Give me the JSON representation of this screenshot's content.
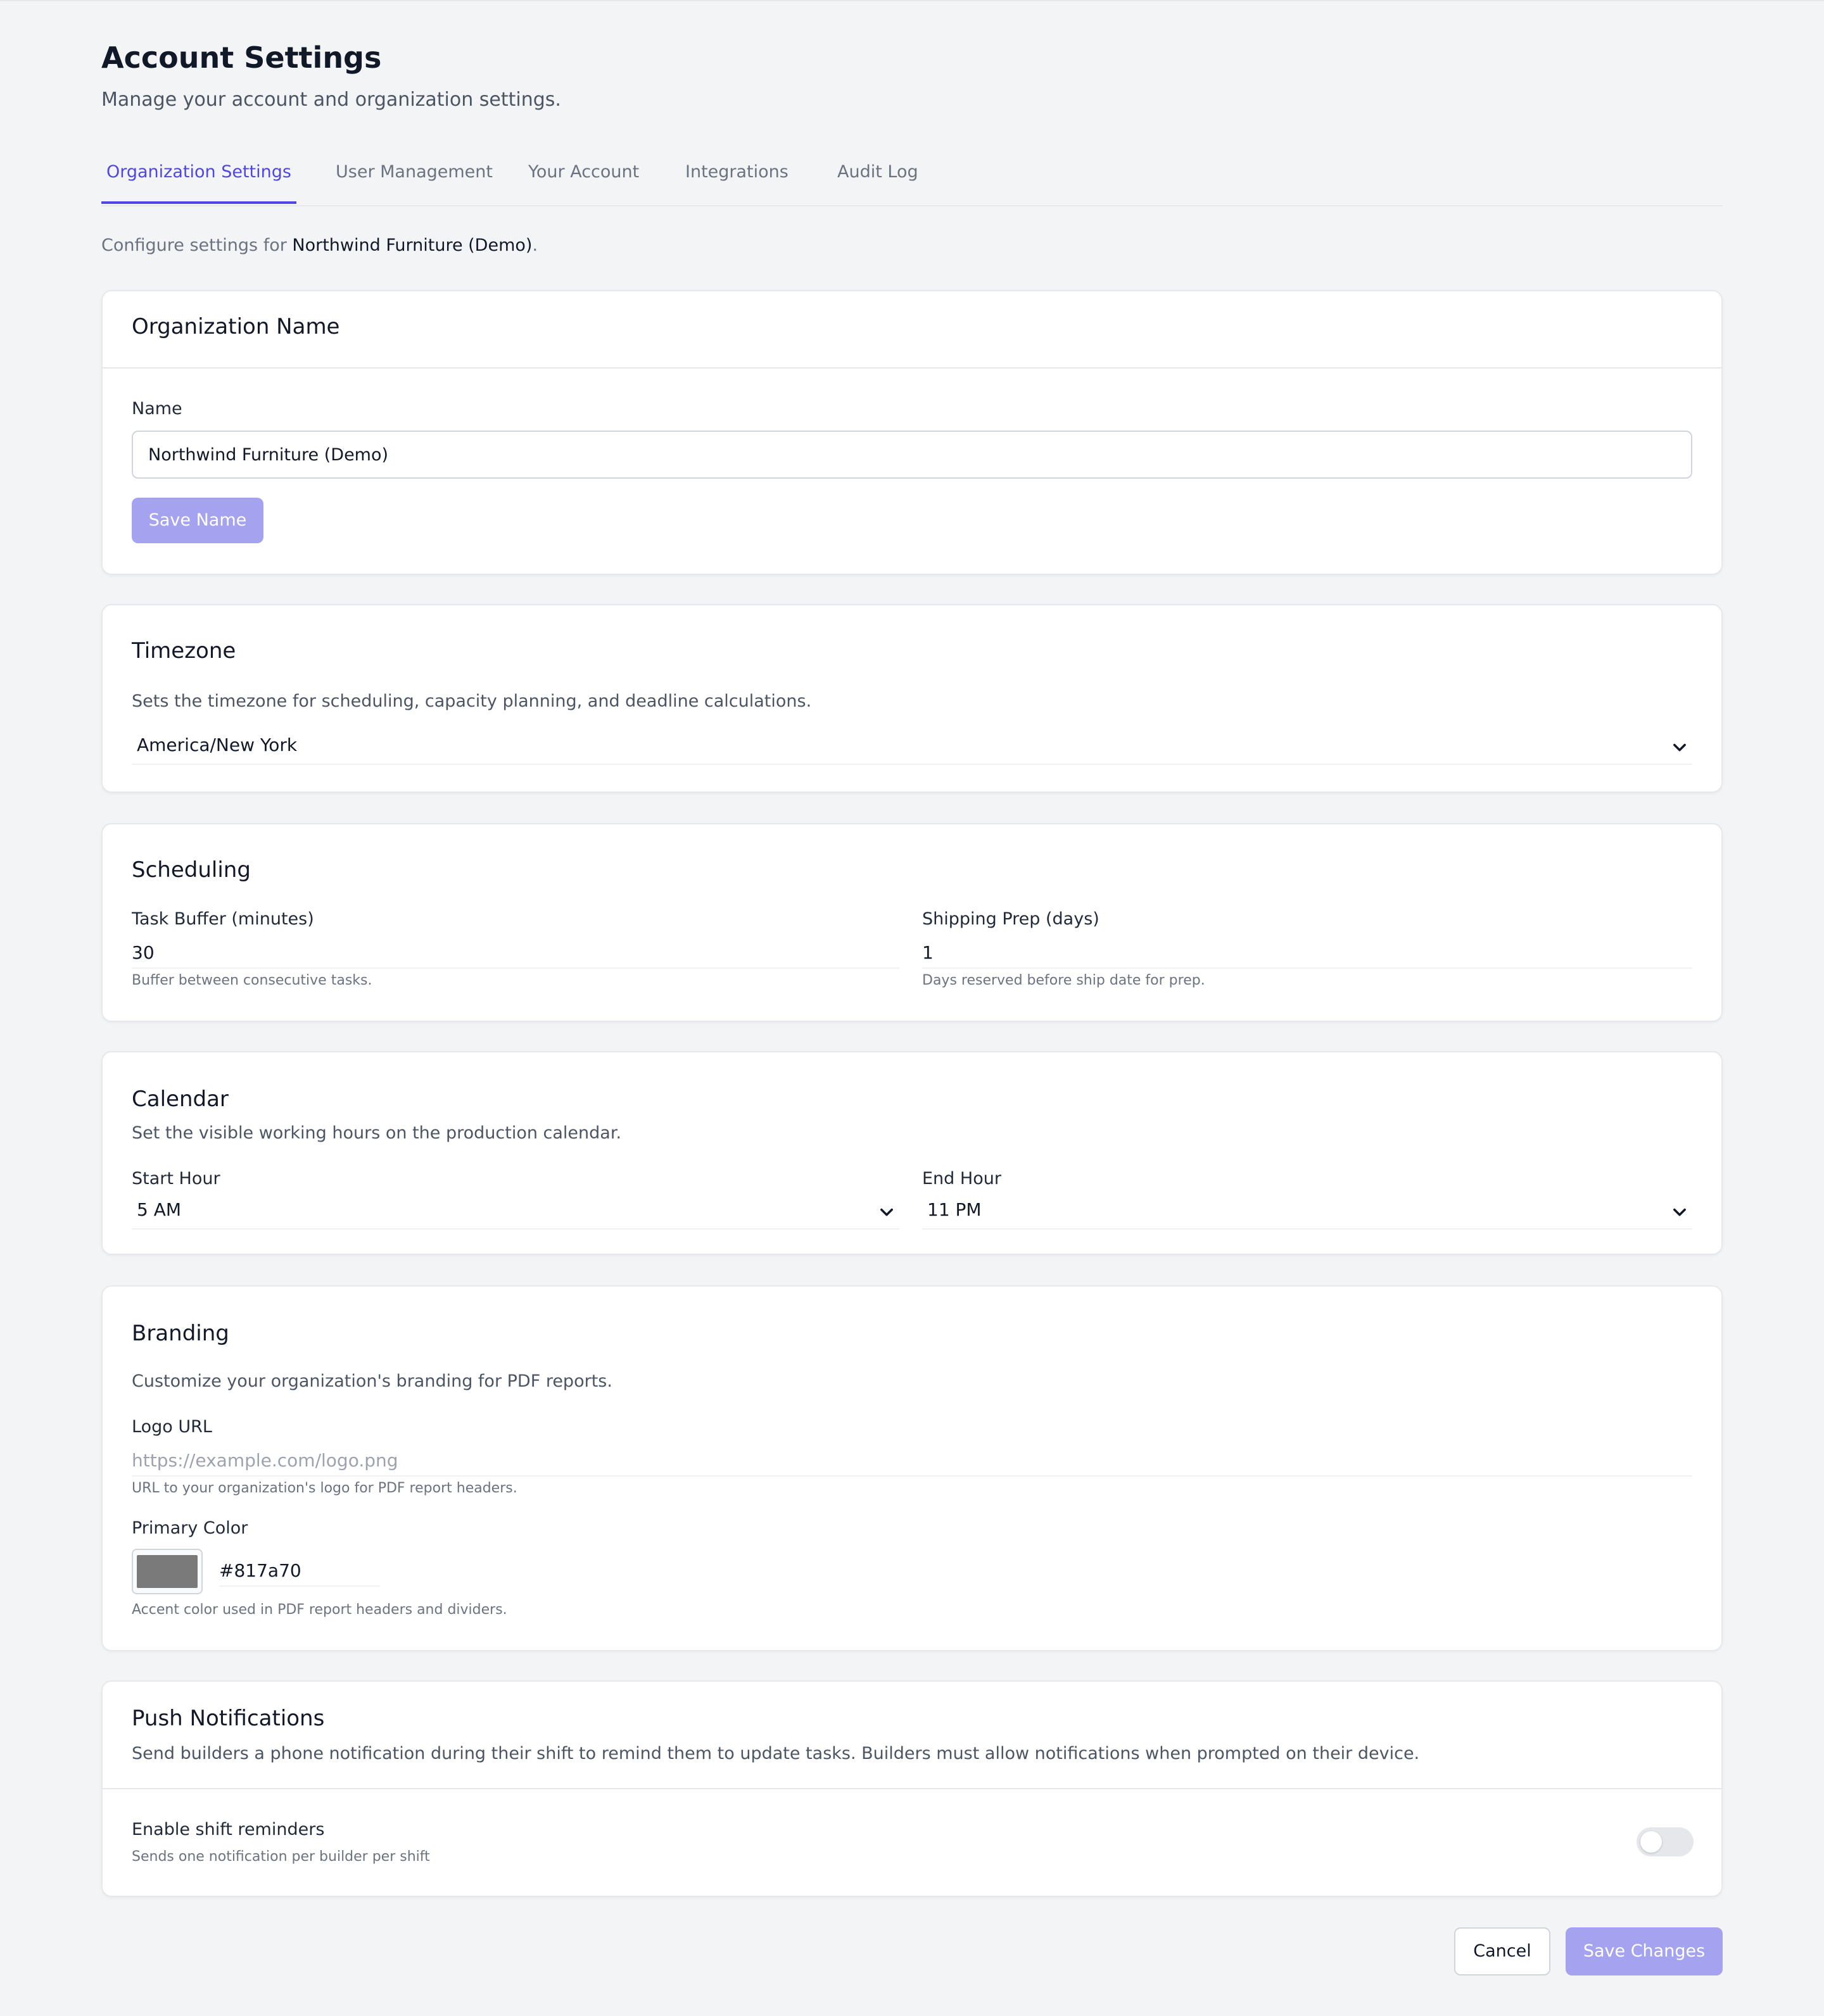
{
  "header": {
    "title": "Account Settings",
    "subtitle": "Manage your account and organization settings."
  },
  "tabs": [
    {
      "label": "Organization Settings",
      "active": true
    },
    {
      "label": "User Management",
      "active": false
    },
    {
      "label": "Your Account",
      "active": false
    },
    {
      "label": "Integrations",
      "active": false
    },
    {
      "label": "Audit Log",
      "active": false
    }
  ],
  "configure": {
    "prefix": "Configure settings for ",
    "org": "Northwind Furniture (Demo)",
    "suffix": "."
  },
  "org_name": {
    "title": "Organization Name",
    "name_label": "Name",
    "name_value": "Northwind Furniture (Demo)",
    "save_label": "Save Name"
  },
  "timezone": {
    "title": "Timezone",
    "description": "Sets the timezone for scheduling, capacity planning, and deadline calculations.",
    "selected": "America/New York"
  },
  "scheduling": {
    "title": "Scheduling",
    "task_buffer_label": "Task Buffer (minutes)",
    "task_buffer_value": "30",
    "task_buffer_help": "Buffer between consecutive tasks.",
    "shipping_prep_label": "Shipping Prep (days)",
    "shipping_prep_value": "1",
    "shipping_prep_help": "Days reserved before ship date for prep."
  },
  "calendar": {
    "title": "Calendar",
    "description": "Set the visible working hours on the production calendar.",
    "start_label": "Start Hour",
    "start_value": "5 AM",
    "end_label": "End Hour",
    "end_value": "11 PM"
  },
  "branding": {
    "title": "Branding",
    "description": "Customize your organization's branding for PDF reports.",
    "logo_label": "Logo URL",
    "logo_placeholder": "https://example.com/logo.png",
    "logo_help": "URL to your organization's logo for PDF report headers.",
    "color_label": "Primary Color",
    "color_value": "#817a70",
    "swatch_color": "#7a7a7a",
    "color_help": "Accent color used in PDF report headers and dividers."
  },
  "push": {
    "title": "Push Notifications",
    "description": "Send builders a phone notification during their shift to remind them to update tasks. Builders must allow notifications when prompted on their device.",
    "toggle_label": "Enable shift reminders",
    "toggle_help": "Sends one notification per builder per shift",
    "toggle_on": false
  },
  "footer": {
    "cancel_label": "Cancel",
    "save_label": "Save Changes"
  },
  "colors": {
    "accent": "#4f46e5",
    "button_disabled": "#a5a3ef",
    "background": "#f3f4f6"
  }
}
